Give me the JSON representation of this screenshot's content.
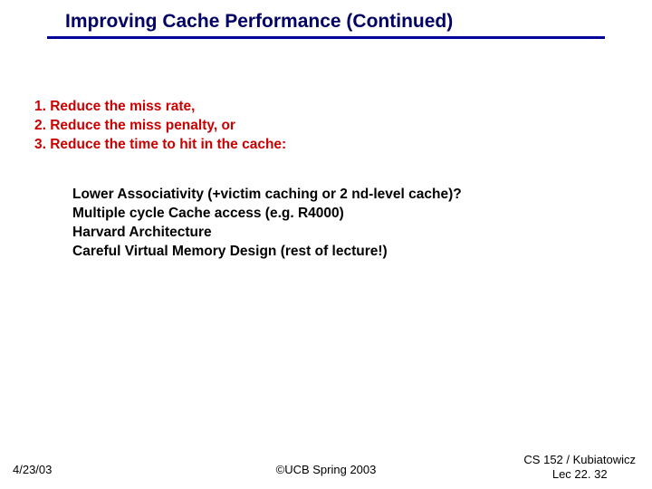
{
  "title": "Improving Cache Performance (Continued)",
  "red": {
    "i1": "1. Reduce the miss rate,",
    "i2": "2. Reduce the miss penalty, or",
    "i3": "3. Reduce the time to hit in the cache:"
  },
  "sub": {
    "s1": "Lower Associativity (+victim caching or 2 nd-level cache)?",
    "s2": "Multiple cycle Cache access (e.g. R4000)",
    "s3": "Harvard Architecture",
    "s4": "Careful Virtual Memory Design (rest of lecture!)"
  },
  "footer": {
    "date": "4/23/03",
    "center": "©UCB Spring 2003",
    "right1": "CS 152 / Kubiatowicz",
    "right2": "Lec 22. 32"
  }
}
